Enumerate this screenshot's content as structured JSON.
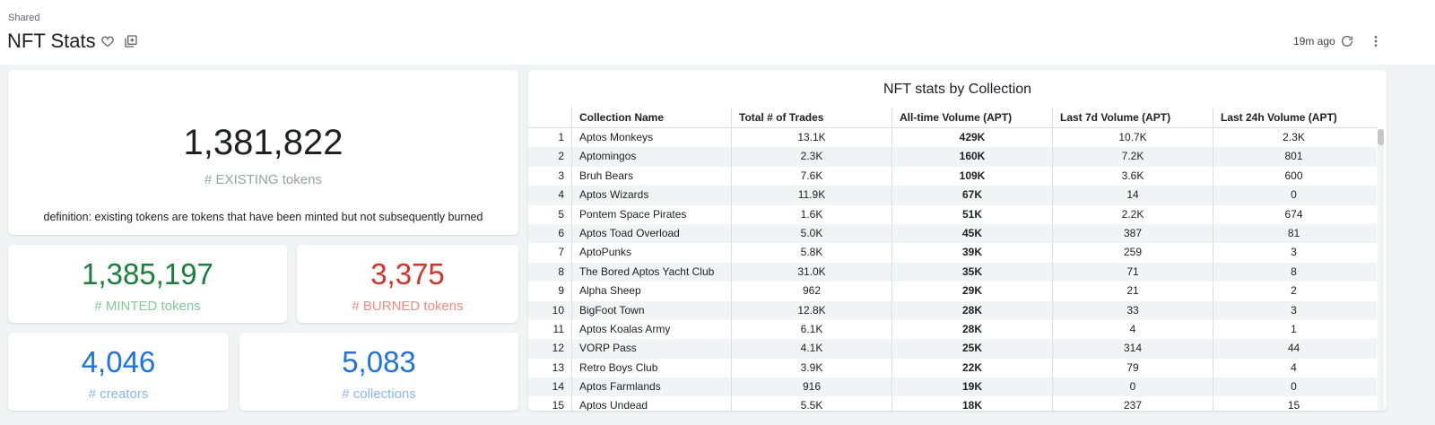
{
  "header": {
    "breadcrumb": "Shared",
    "title": "NFT Stats",
    "updated": "19m ago",
    "icons": [
      "heart-icon",
      "copy-icon",
      "refresh-icon",
      "more-vert-icon"
    ]
  },
  "scorecards": {
    "existing": {
      "value": "1,381,822",
      "label": "# EXISTING tokens",
      "definition": "definition: existing tokens are tokens that have been minted but not subsequently burned"
    },
    "minted": {
      "value": "1,385,197",
      "label": "# MINTED tokens"
    },
    "burned": {
      "value": "3,375",
      "label": "# BURNED tokens"
    },
    "creators": {
      "value": "4,046",
      "label": "# creators"
    },
    "collections": {
      "value": "5,083",
      "label": "# collections"
    }
  },
  "colors": {
    "minted": "#188038",
    "burned": "#d93025",
    "blue": "#1a73e8"
  },
  "table": {
    "title": "NFT stats by Collection",
    "columns": [
      "Collection Name",
      "Total # of Trades",
      "All-time Volume (APT)",
      "Last 7d Volume (APT)",
      "Last 24h Volume (APT)"
    ],
    "rows": [
      [
        "1",
        "Aptos Monkeys",
        "13.1K",
        "429K",
        "10.7K",
        "2.3K"
      ],
      [
        "2",
        "Aptomingos",
        "2.3K",
        "160K",
        "7.2K",
        "801"
      ],
      [
        "3",
        "Bruh Bears",
        "7.6K",
        "109K",
        "3.6K",
        "600"
      ],
      [
        "4",
        "Aptos Wizards",
        "11.9K",
        "67K",
        "14",
        "0"
      ],
      [
        "5",
        "Pontem Space Pirates",
        "1.6K",
        "51K",
        "2.2K",
        "674"
      ],
      [
        "6",
        "Aptos Toad Overload",
        "5.0K",
        "45K",
        "387",
        "81"
      ],
      [
        "7",
        "AptoPunks",
        "5.8K",
        "39K",
        "259",
        "3"
      ],
      [
        "8",
        "The Bored Aptos Yacht Club",
        "31.0K",
        "35K",
        "71",
        "8"
      ],
      [
        "9",
        "Alpha Sheep",
        "962",
        "29K",
        "21",
        "2"
      ],
      [
        "10",
        "BigFoot Town",
        "12.8K",
        "28K",
        "33",
        "3"
      ],
      [
        "11",
        "Aptos Koalas Army",
        "6.1K",
        "28K",
        "4",
        "1"
      ],
      [
        "12",
        "VORP Pass",
        "4.1K",
        "25K",
        "314",
        "44"
      ],
      [
        "13",
        "Retro Boys Club",
        "3.9K",
        "22K",
        "79",
        "4"
      ],
      [
        "14",
        "Aptos Farmlands",
        "916",
        "19K",
        "0",
        "0"
      ],
      [
        "15",
        "Aptos Undead",
        "5.5K",
        "18K",
        "237",
        "15"
      ]
    ]
  }
}
